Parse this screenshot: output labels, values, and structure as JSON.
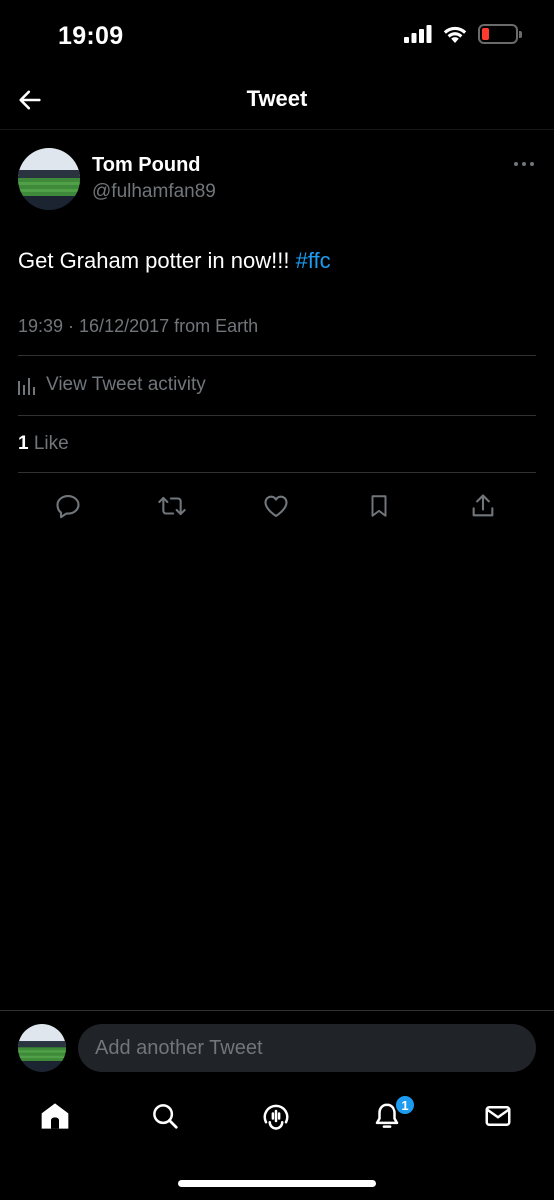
{
  "status_bar": {
    "time": "19:09"
  },
  "header": {
    "title": "Tweet"
  },
  "tweet": {
    "author_name": "Tom Pound",
    "author_handle": "@fulhamfan89",
    "text": "Get Graham potter in now!!!",
    "hashtag": "#ffc",
    "meta": "19:39 · 16/12/2017 from Earth",
    "activity_label": "View Tweet activity",
    "likes_count": "1",
    "likes_label": " Like"
  },
  "reply": {
    "placeholder": "Add another Tweet"
  },
  "tab_bar": {
    "notification_count": "1"
  },
  "colors": {
    "accent": "#1d9bf0",
    "background": "#000000",
    "secondary_text": "#71767b",
    "battery_low": "#ff3b30"
  },
  "icons": [
    "back-arrow-icon",
    "more-icon",
    "bar-chart-icon",
    "reply-icon",
    "retweet-icon",
    "like-icon",
    "bookmark-icon",
    "share-icon",
    "home-icon",
    "search-icon",
    "spaces-icon",
    "bell-icon",
    "mail-icon"
  ]
}
